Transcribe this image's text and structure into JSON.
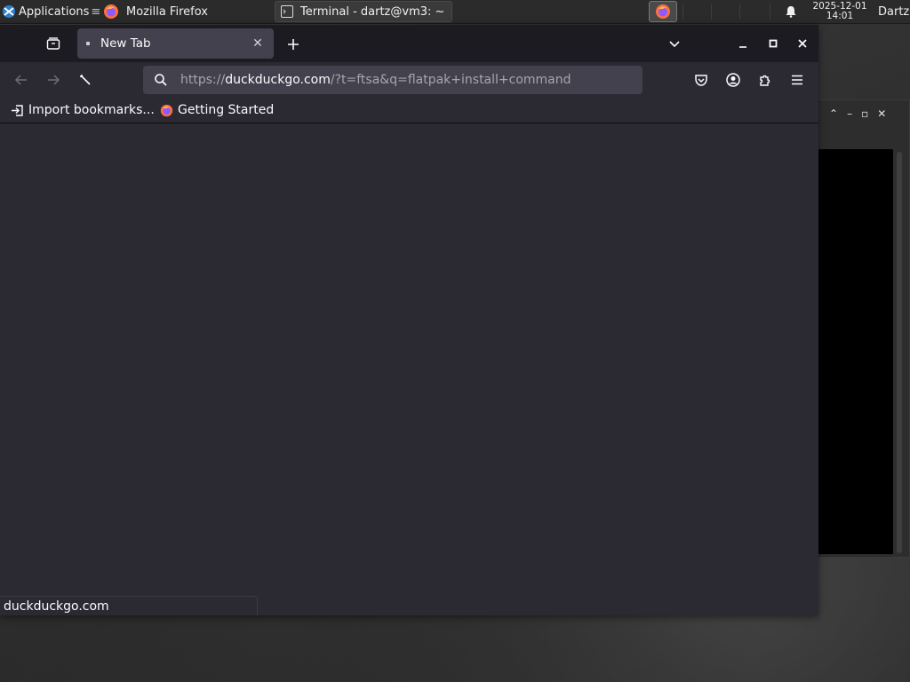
{
  "panel": {
    "applications_label": "Applications",
    "task_firefox_label": "Mozilla Firefox",
    "task_terminal_label": "Terminal - dartz@vm3: ~",
    "clock_date": "2025-12-01",
    "clock_time": "14:01",
    "user_label": "Dartz"
  },
  "firefox": {
    "tab_title": "New Tab",
    "url_scheme": "https://",
    "url_host": "duckduckgo.com",
    "url_rest": "/?t=ftsa&q=flatpak+install+command",
    "bookmarks": {
      "import_label": "Import bookmarks...",
      "getting_started_label": "Getting Started"
    },
    "status_text": "duckduckgo.com"
  },
  "icons": {
    "applications": "xfce-logo-icon",
    "firefox": "firefox-icon",
    "terminal": "terminal-icon",
    "notification": "bell-icon",
    "back": "arrow-left-icon",
    "forward": "arrow-right-icon",
    "stop": "stop-icon",
    "search": "search-icon",
    "pocket": "pocket-icon",
    "account": "account-icon",
    "extensions": "puzzle-icon",
    "menu": "hamburger-menu-icon"
  },
  "colors": {
    "firefox_chrome": "#1c1b22",
    "firefox_toolbar": "#2b2a33",
    "firefox_field": "#42414d",
    "panel": "#2b2b2b"
  }
}
